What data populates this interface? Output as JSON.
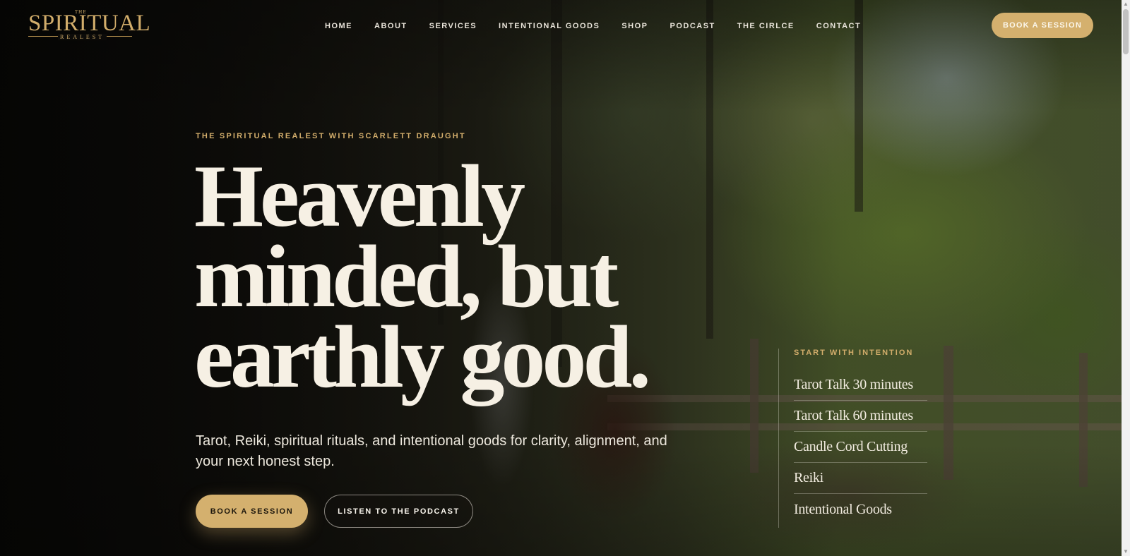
{
  "logo": {
    "the": "THE",
    "main": "SPIRITUAL",
    "sub": "REALEST"
  },
  "nav": {
    "items": [
      "HOME",
      "ABOUT",
      "SERVICES",
      "INTENTIONAL GOODS",
      "SHOP",
      "PODCAST",
      "THE CIRLCE",
      "CONTACT"
    ],
    "cta": "BOOK A SESSION"
  },
  "hero": {
    "eyebrow": "THE SPIRITUAL REALEST WITH SCARLETT DRAUGHT",
    "headline": [
      "Heavenly",
      "minded, but",
      "earthly good."
    ],
    "subhead": "Tarot, Reiki, spiritual rituals, and intentional goods for clarity, alignment, and your next honest step.",
    "primary_cta": "BOOK A SESSION",
    "secondary_cta": "LISTEN TO THE PODCAST"
  },
  "side_panel": {
    "title": "START WITH INTENTION",
    "items": [
      "Tarot Talk 30 minutes",
      "Tarot Talk 60 minutes",
      "Candle Cord Cutting",
      "Reiki",
      "Intentional Goods"
    ]
  },
  "colors": {
    "gold": "#d4b06e",
    "cream": "#f6f0e4",
    "dark": "#0c0b09"
  }
}
